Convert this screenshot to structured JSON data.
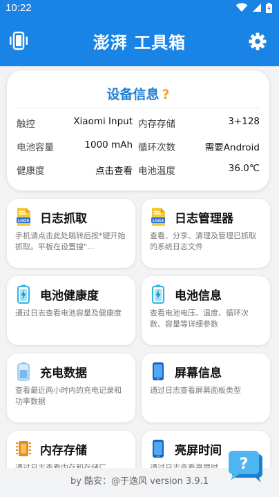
{
  "statusbar": {
    "time": "10:22"
  },
  "appbar": {
    "title": "澎湃 工具箱"
  },
  "device_info": {
    "title": "设备信息",
    "help_mark": "?",
    "rows": [
      {
        "k1": "触控",
        "v1": "Xiaomi Input",
        "k2": "内存存储",
        "v2": "3+128"
      },
      {
        "k1": "电池容量",
        "v1": "1000 mAh",
        "k2": "循环次数",
        "v2": "需要Android"
      },
      {
        "k1": "健康度",
        "v1": "点击查看",
        "k2": "电池温度",
        "v2": "36.0℃"
      }
    ]
  },
  "cards": [
    {
      "title": "日志抓取",
      "desc": "手机请点击此处跳转后按*键开始抓取。平板在设置搜\"...",
      "icon": "log-file-icon"
    },
    {
      "title": "日志管理器",
      "desc": "查看、分享、清理及管理已抓取的系统日志文件",
      "icon": "log-file-icon"
    },
    {
      "title": "电池健康度",
      "desc": "通过日志查看电池容量及健康度",
      "icon": "battery-icon"
    },
    {
      "title": "电池信息",
      "desc": "查看电池电压、温度、循环次数、容量等详细参数",
      "icon": "battery-icon"
    },
    {
      "title": "充电数据",
      "desc": "查看最近两小时内的充电记录和功率数据",
      "icon": "battery-charge-icon"
    },
    {
      "title": "屏幕信息",
      "desc": "通过日志查看屏幕面板类型",
      "icon": "phone-screen-icon"
    },
    {
      "title": "内存存储",
      "desc": "通过日志查看内存和存储厂",
      "icon": "memory-chip-icon"
    },
    {
      "title": "亮屏时间",
      "desc": "通过日志查看亮屏时",
      "icon": "phone-screen-icon"
    }
  ],
  "footer": {
    "text": "by 酷安：@于逸风 version 3.9.1"
  },
  "help_fab": {
    "label": "?"
  },
  "colors": {
    "primary": "#1a84e6",
    "accent_title": "#1e7fd6",
    "help_mark": "#f2a024"
  }
}
